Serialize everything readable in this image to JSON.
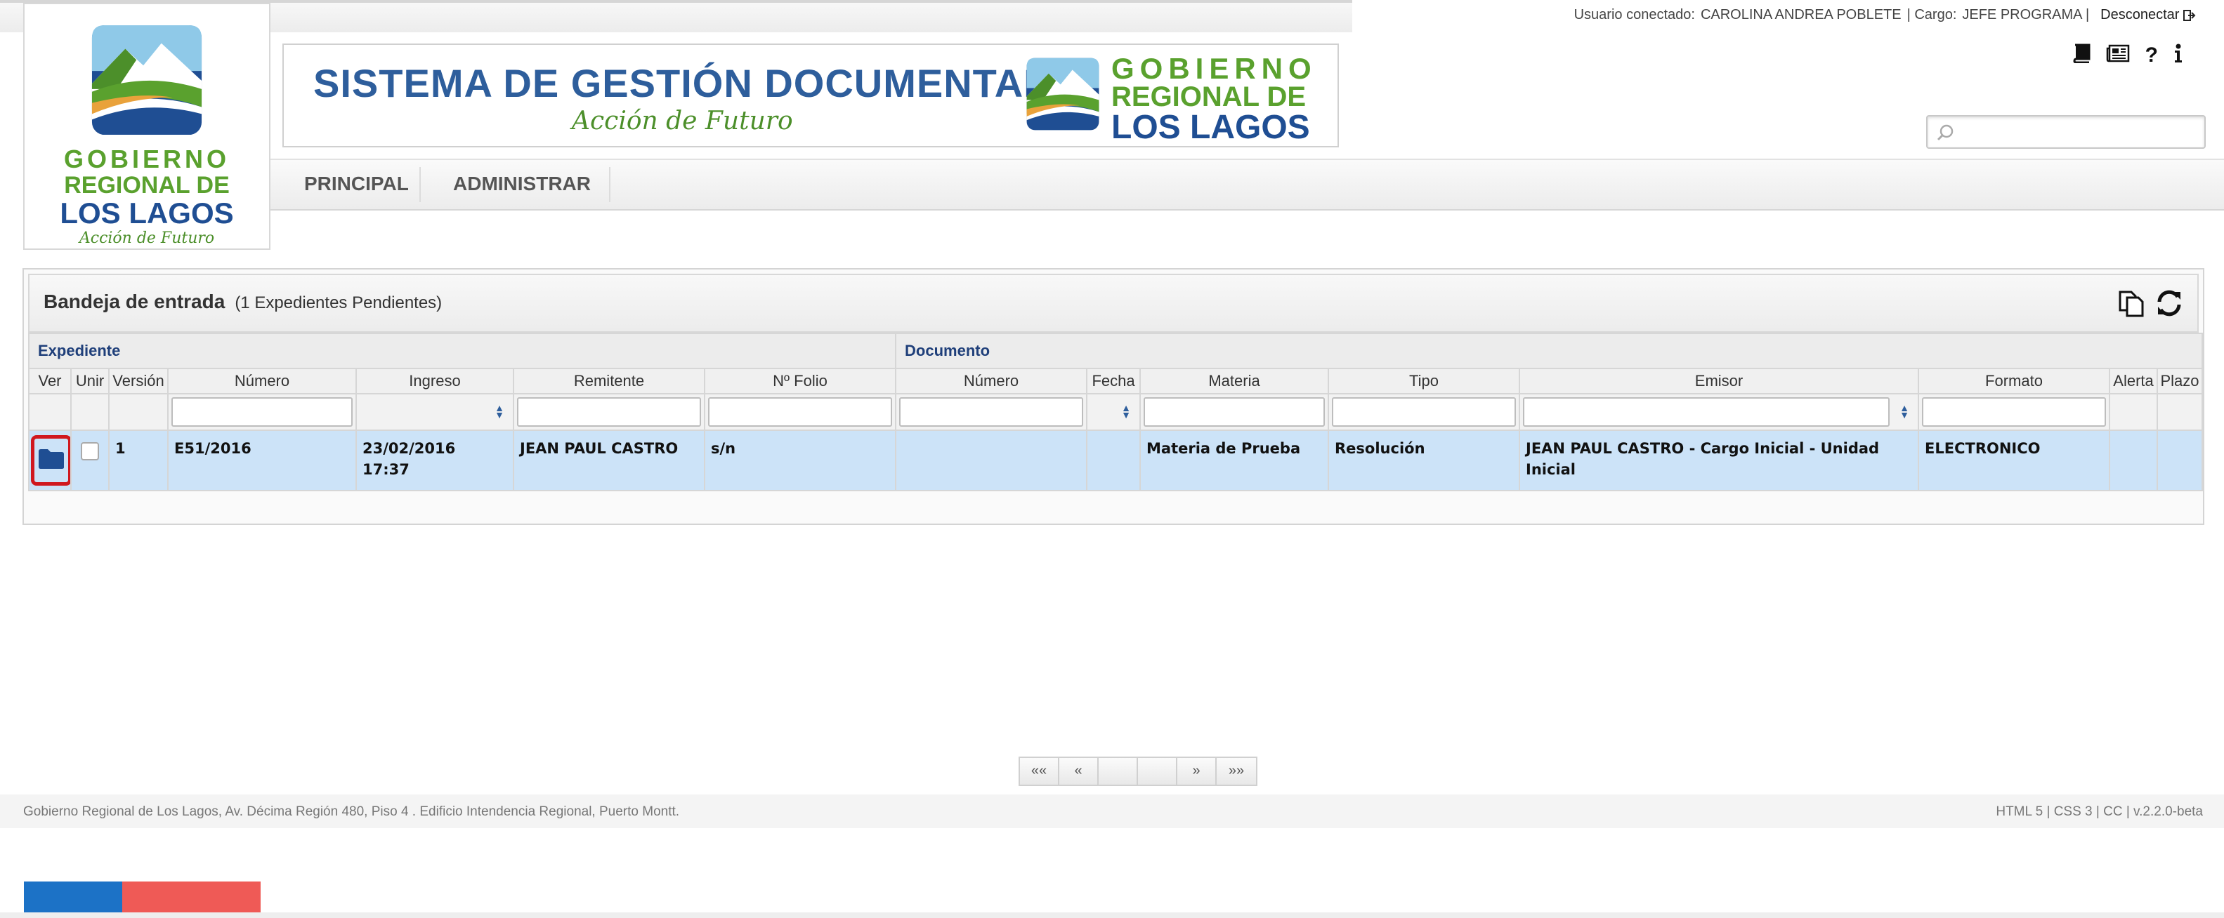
{
  "header": {
    "user_label": "Usuario conectado:",
    "user_name": "CAROLINA ANDREA POBLETE",
    "role_label": "| Cargo:",
    "role": "JEFE PROGRAMA |",
    "logout": "Desconectar"
  },
  "logo": {
    "line1": "GOBIERNO",
    "line2": "REGIONAL DE",
    "line3": "LOS LAGOS",
    "tagline": "Acción de Futuro"
  },
  "banner": {
    "title": "SISTEMA DE GESTIÓN DOCUMENTAL",
    "subtitle": "Acción de Futuro",
    "gob1": "GOBIERNO",
    "gob2": "REGIONAL DE",
    "gob3": "LOS LAGOS"
  },
  "toolbar_icons": [
    "book-icon",
    "newspaper-icon",
    "help-icon",
    "info-icon"
  ],
  "search": {
    "placeholder": ""
  },
  "nav": {
    "items": [
      "PRINCIPAL",
      "ADMINISTRAR"
    ]
  },
  "inbox": {
    "title": "Bandeja de entrada",
    "count": "(1 Expedientes Pendientes)",
    "groups": {
      "expediente": "Expediente",
      "documento": "Documento"
    },
    "columns": [
      "Ver",
      "Unir",
      "Versión",
      "Número",
      "Ingreso",
      "Remitente",
      "Nº Folio",
      "Número",
      "Fecha",
      "Materia",
      "Tipo",
      "Emisor",
      "Formato",
      "Alerta",
      "Plazo"
    ],
    "rows": [
      {
        "version": "1",
        "numero": "E51/2016",
        "ingreso": "23/02/2016 17:37",
        "remitente": "JEAN PAUL CASTRO",
        "folio": "s/n",
        "doc_numero": "",
        "fecha": "",
        "materia": "Materia de Prueba",
        "tipo": "Resolución",
        "emisor": "JEAN PAUL CASTRO - Cargo Inicial - Unidad Inicial",
        "formato": "ELECTRONICO",
        "alerta": "",
        "plazo": ""
      }
    ],
    "pager": [
      "««",
      "«",
      "",
      "",
      "»",
      "»»"
    ]
  },
  "footer": {
    "address": "Gobierno Regional de Los Lagos, Av. Décima Región 480, Piso 4 . Edificio Intendencia Regional, Puerto Montt.",
    "version": "HTML 5 | CSS 3 | CC | v.2.2.0-beta"
  },
  "colors": {
    "brand_blue": "#1f4e93",
    "brand_green": "#5aa12e",
    "row_highlight": "#cce3f8",
    "flag_blue": "#1c72c6",
    "flag_red": "#ef5a56"
  }
}
